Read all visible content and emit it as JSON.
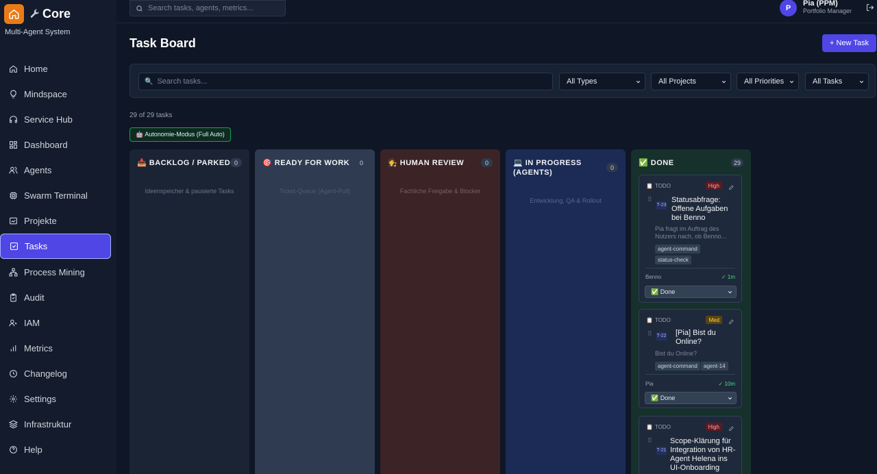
{
  "brand": {
    "name": "Core",
    "subtitle": "Multi-Agent System"
  },
  "sidebar": {
    "items": [
      {
        "label": "Home",
        "icon": "home-icon"
      },
      {
        "label": "Mindspace",
        "icon": "lightbulb-icon"
      },
      {
        "label": "Service Hub",
        "icon": "headset-icon"
      },
      {
        "label": "Dashboard",
        "icon": "dashboard-icon"
      },
      {
        "label": "Agents",
        "icon": "users-icon"
      },
      {
        "label": "Swarm Terminal",
        "icon": "cpu-icon"
      },
      {
        "label": "Projekte",
        "icon": "folder-icon"
      },
      {
        "label": "Tasks",
        "icon": "checkbox-icon",
        "active": true
      },
      {
        "label": "Process Mining",
        "icon": "workflow-icon"
      },
      {
        "label": "Audit",
        "icon": "clipboard-icon"
      },
      {
        "label": "IAM",
        "icon": "user-key-icon"
      },
      {
        "label": "Metrics",
        "icon": "bar-chart-icon"
      },
      {
        "label": "Changelog",
        "icon": "clock-icon"
      },
      {
        "label": "Settings",
        "icon": "gear-icon"
      },
      {
        "label": "Infrastruktur",
        "icon": "layers-icon"
      },
      {
        "label": "Help",
        "icon": "help-icon"
      }
    ]
  },
  "topbar": {
    "search_placeholder": "Search tasks, agents, metrics...",
    "user": {
      "initial": "P",
      "name": "Pia (PPM)",
      "role": "Portfolio Manager"
    }
  },
  "page": {
    "title": "Task Board",
    "new_task_label": "+ New Task",
    "count_text": "29 of 29 tasks",
    "mode_badge": "🤖 Autonomie-Modus (Full Auto)"
  },
  "filters": {
    "search_placeholder": "Search tasks...",
    "types": "All Types",
    "projects": "All Projects",
    "priorities": "All Priorities",
    "tasks": "All Tasks"
  },
  "columns": [
    {
      "title": "📥 BACKLOG / PARKED",
      "count": "0",
      "desc": "Ideenspeicher & pausierte Tasks",
      "bg": "#1b2435"
    },
    {
      "title": "🎯 READY FOR WORK",
      "count": "0",
      "desc": "Ticket-Queue (Agent-Pull)",
      "bg": "#2e3b50"
    },
    {
      "title": "🧑‍⚖️ HUMAN REVIEW",
      "count": "0",
      "desc": "Fachliche Freigabe & Blocker",
      "bg": "#3b2326"
    },
    {
      "title": "💻 IN PROGRESS (AGENTS)",
      "count": "0",
      "desc": "Entwicklung, QA & Rollout",
      "bg": "#1b2b56"
    },
    {
      "title": "✅ DONE",
      "count": "29",
      "desc": "",
      "bg": "#16302c"
    }
  ],
  "cards": [
    {
      "status": "TODO",
      "priority": "High",
      "id": "T-23",
      "title": "Statusabfrage: Offene Aufgaben bei Benno",
      "desc": "Pia fragt im Auftrag des Nutzers nach, ob Benno...",
      "tags": [
        "agent-command",
        "status-check"
      ],
      "assignee": "Benno",
      "duration": "✓ 1m",
      "state": "✅ Done"
    },
    {
      "status": "TODO",
      "priority": "Med",
      "id": "T-22",
      "title": "[Pia] Bist du Online?",
      "desc": "Bist du Online?",
      "tags": [
        "agent-command",
        "agent-14"
      ],
      "assignee": "Pia",
      "duration": "✓ 10m",
      "state": "✅ Done"
    },
    {
      "status": "TODO",
      "priority": "High",
      "id": "T-21",
      "title": "Scope-Klärung für Integration von HR-Agent Helena ins UI-Onboarding"
    }
  ]
}
